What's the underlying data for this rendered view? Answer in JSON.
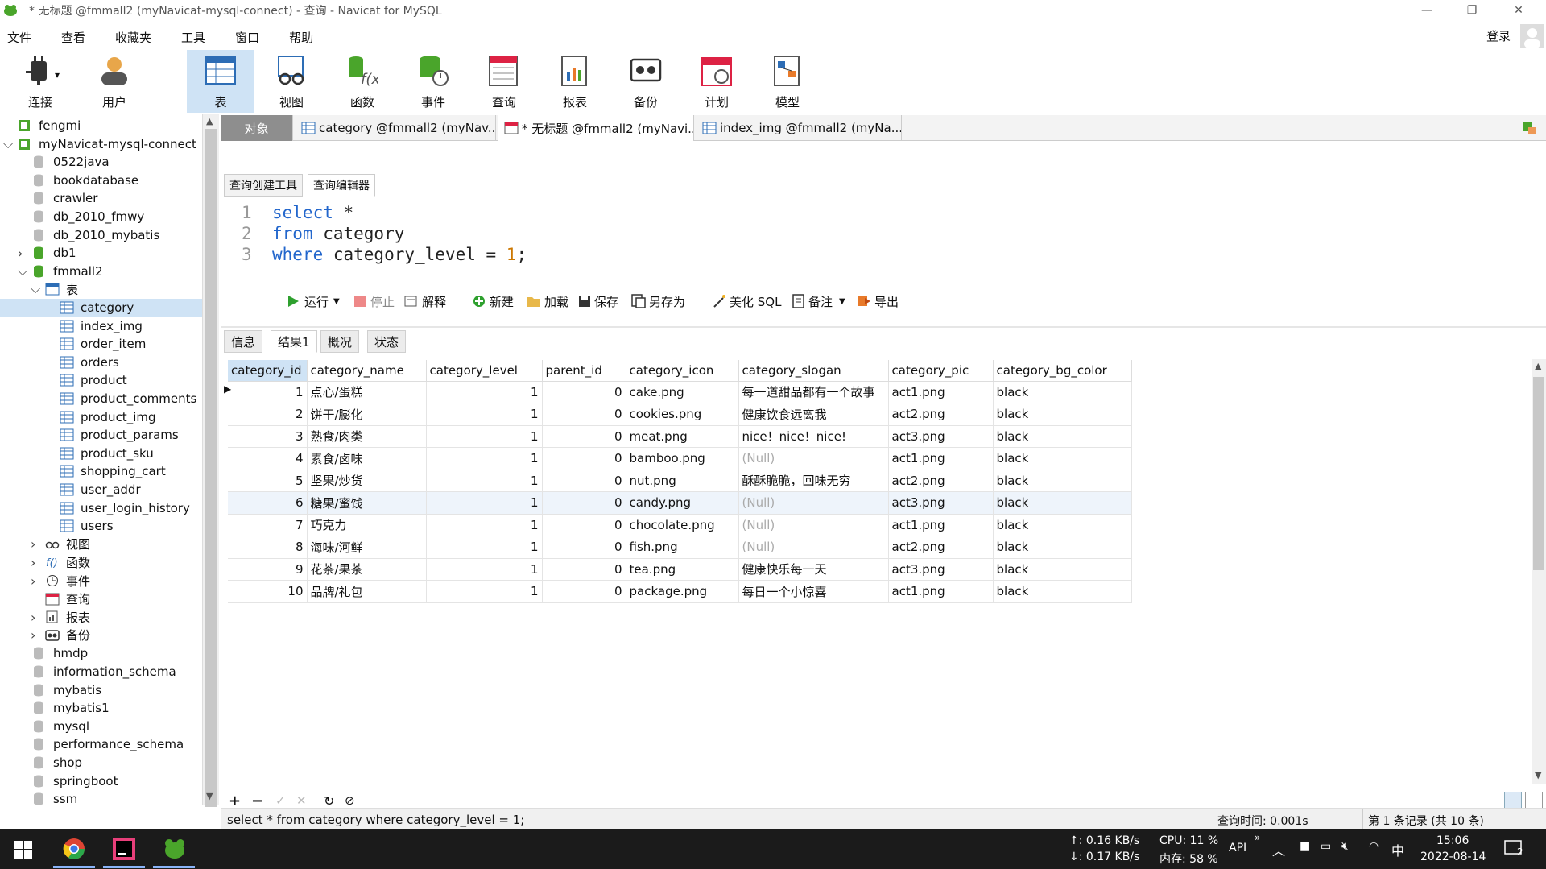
{
  "window": {
    "title": "* 无标题 @fmmall2 (myNavicat-mysql-connect) - 查询 - Navicat for MySQL",
    "minimize_icon": "minimize-icon",
    "restore_icon": "restore-icon",
    "close_icon": "close-icon"
  },
  "menu": [
    "文件",
    "查看",
    "收藏夹",
    "工具",
    "窗口",
    "帮助"
  ],
  "login_label": "登录",
  "toolbar": [
    {
      "label": "连接",
      "icon": "plug-icon"
    },
    {
      "label": "用户",
      "icon": "user-icon"
    },
    {
      "label": "表",
      "icon": "table-icon"
    },
    {
      "label": "视图",
      "icon": "view-icon"
    },
    {
      "label": "函数",
      "icon": "function-icon"
    },
    {
      "label": "事件",
      "icon": "event-icon"
    },
    {
      "label": "查询",
      "icon": "query-icon"
    },
    {
      "label": "报表",
      "icon": "report-icon"
    },
    {
      "label": "备份",
      "icon": "backup-icon"
    },
    {
      "label": "计划",
      "icon": "calendar-icon"
    },
    {
      "label": "模型",
      "icon": "model-icon"
    }
  ],
  "sidebar": {
    "items": [
      {
        "label": "fengmi",
        "indent": 0,
        "icon": "connection-icon",
        "arrow": ""
      },
      {
        "label": "myNavicat-mysql-connect",
        "indent": 0,
        "icon": "connection-icon",
        "arrow": "v"
      },
      {
        "label": "0522java",
        "indent": 1,
        "icon": "database-icon",
        "arrow": ""
      },
      {
        "label": "bookdatabase",
        "indent": 1,
        "icon": "database-icon",
        "arrow": ""
      },
      {
        "label": "crawler",
        "indent": 1,
        "icon": "database-icon",
        "arrow": ""
      },
      {
        "label": "db_2010_fmwy",
        "indent": 1,
        "icon": "database-icon",
        "arrow": ""
      },
      {
        "label": "db_2010_mybatis",
        "indent": 1,
        "icon": "database-icon",
        "arrow": ""
      },
      {
        "label": "db1",
        "indent": 1,
        "icon": "database-open-icon",
        "arrow": ">"
      },
      {
        "label": "fmmall2",
        "indent": 1,
        "icon": "database-open-icon",
        "arrow": "v"
      },
      {
        "label": "表",
        "indent": 2,
        "icon": "table-folder-icon",
        "arrow": "v"
      },
      {
        "label": "category",
        "indent": 3,
        "icon": "table-icon",
        "arrow": "",
        "selected": true
      },
      {
        "label": "index_img",
        "indent": 3,
        "icon": "table-icon",
        "arrow": ""
      },
      {
        "label": "order_item",
        "indent": 3,
        "icon": "table-icon",
        "arrow": ""
      },
      {
        "label": "orders",
        "indent": 3,
        "icon": "table-icon",
        "arrow": ""
      },
      {
        "label": "product",
        "indent": 3,
        "icon": "table-icon",
        "arrow": ""
      },
      {
        "label": "product_comments",
        "indent": 3,
        "icon": "table-icon",
        "arrow": ""
      },
      {
        "label": "product_img",
        "indent": 3,
        "icon": "table-icon",
        "arrow": ""
      },
      {
        "label": "product_params",
        "indent": 3,
        "icon": "table-icon",
        "arrow": ""
      },
      {
        "label": "product_sku",
        "indent": 3,
        "icon": "table-icon",
        "arrow": ""
      },
      {
        "label": "shopping_cart",
        "indent": 3,
        "icon": "table-icon",
        "arrow": ""
      },
      {
        "label": "user_addr",
        "indent": 3,
        "icon": "table-icon",
        "arrow": ""
      },
      {
        "label": "user_login_history",
        "indent": 3,
        "icon": "table-icon",
        "arrow": ""
      },
      {
        "label": "users",
        "indent": 3,
        "icon": "table-icon",
        "arrow": ""
      },
      {
        "label": "视图",
        "indent": 2,
        "icon": "view-icon",
        "arrow": ">"
      },
      {
        "label": "函数",
        "indent": 2,
        "icon": "function-icon",
        "arrow": ">"
      },
      {
        "label": "事件",
        "indent": 2,
        "icon": "event-icon",
        "arrow": ">"
      },
      {
        "label": "查询",
        "indent": 2,
        "icon": "query-icon",
        "arrow": ""
      },
      {
        "label": "报表",
        "indent": 2,
        "icon": "report-icon",
        "arrow": ">"
      },
      {
        "label": "备份",
        "indent": 2,
        "icon": "backup-icon",
        "arrow": ">"
      },
      {
        "label": "hmdp",
        "indent": 1,
        "icon": "database-icon",
        "arrow": ""
      },
      {
        "label": "information_schema",
        "indent": 1,
        "icon": "database-icon",
        "arrow": ""
      },
      {
        "label": "mybatis",
        "indent": 1,
        "icon": "database-icon",
        "arrow": ""
      },
      {
        "label": "mybatis1",
        "indent": 1,
        "icon": "database-icon",
        "arrow": ""
      },
      {
        "label": "mysql",
        "indent": 1,
        "icon": "database-icon",
        "arrow": ""
      },
      {
        "label": "performance_schema",
        "indent": 1,
        "icon": "database-icon",
        "arrow": ""
      },
      {
        "label": "shop",
        "indent": 1,
        "icon": "database-icon",
        "arrow": ""
      },
      {
        "label": "springboot",
        "indent": 1,
        "icon": "database-icon",
        "arrow": ""
      },
      {
        "label": "ssm",
        "indent": 1,
        "icon": "database-icon",
        "arrow": ""
      }
    ]
  },
  "tabs": [
    {
      "label": "对象",
      "active": false
    },
    {
      "label": "category @fmmall2 (myNav...",
      "icon": "table-icon"
    },
    {
      "label": "* 无标题 @fmmall2 (myNavi...",
      "icon": "query-icon",
      "active": true
    },
    {
      "label": "index_img @fmmall2 (myNa...",
      "icon": "table-icon"
    }
  ],
  "query_toolbar": {
    "run": "运行",
    "stop": "停止",
    "explain": "解释",
    "new": "新建",
    "load": "加载",
    "save": "保存",
    "save_as": "另存为",
    "beautify": "美化 SQL",
    "comment": "备注",
    "export": "导出"
  },
  "subtabs": [
    "查询创建工具",
    "查询编辑器"
  ],
  "editor": {
    "lines": [
      {
        "num": "1",
        "kw": "select",
        "rest": " *"
      },
      {
        "num": "2",
        "kw": "from",
        "rest": " category"
      },
      {
        "num": "3",
        "kw": "where",
        "rest": " category_level = ",
        "num_val": "1",
        "end": ";"
      }
    ]
  },
  "result_tabs": [
    "信息",
    "结果1",
    "概况",
    "状态"
  ],
  "table": {
    "columns": [
      "category_id",
      "category_name",
      "category_level",
      "parent_id",
      "category_icon",
      "category_slogan",
      "category_pic",
      "category_bg_color"
    ],
    "rows": [
      [
        "1",
        "点心/蛋糕",
        "1",
        "0",
        "cake.png",
        "每一道甜品都有一个故事",
        "act1.png",
        "black"
      ],
      [
        "2",
        "饼干/膨化",
        "1",
        "0",
        "cookies.png",
        "健康饮食远离我",
        "act2.png",
        "black"
      ],
      [
        "3",
        "熟食/肉类",
        "1",
        "0",
        "meat.png",
        "nice！nice！nice!",
        "act3.png",
        "black"
      ],
      [
        "4",
        "素食/卤味",
        "1",
        "0",
        "bamboo.png",
        "(Null)",
        "act1.png",
        "black"
      ],
      [
        "5",
        "坚果/炒货",
        "1",
        "0",
        "nut.png",
        "酥酥脆脆，回味无穷",
        "act2.png",
        "black"
      ],
      [
        "6",
        "糖果/蜜饯",
        "1",
        "0",
        "candy.png",
        "(Null)",
        "act3.png",
        "black"
      ],
      [
        "7",
        "巧克力",
        "1",
        "0",
        "chocolate.png",
        "(Null)",
        "act1.png",
        "black"
      ],
      [
        "8",
        "海味/河鲜",
        "1",
        "0",
        "fish.png",
        "(Null)",
        "act2.png",
        "black"
      ],
      [
        "9",
        "花茶/果茶",
        "1",
        "0",
        "tea.png",
        "健康快乐每一天",
        "act3.png",
        "black"
      ],
      [
        "10",
        "品牌/礼包",
        "1",
        "0",
        "package.png",
        "每日一个小惊喜",
        "act1.png",
        "black"
      ]
    ]
  },
  "status": {
    "sql": "select * from category where category_level = 1;",
    "query_time": "查询时间: 0.001s",
    "record": "第 1 条记录 (共 10 条)"
  },
  "taskbar": {
    "net_up": "↑: 0.16 KB/s",
    "net_down": "↓: 0.17 KB/s",
    "cpu": "CPU: 11 %",
    "mem": "内存: 58 %",
    "api": "API",
    "ime": "中",
    "time": "15:06",
    "date": "2022-08-14",
    "notif": "2"
  },
  "colors": {
    "accent": "#cfe3f5",
    "keyword": "#2266cc",
    "number": "#cc7700",
    "null": "#aaaaaa"
  }
}
